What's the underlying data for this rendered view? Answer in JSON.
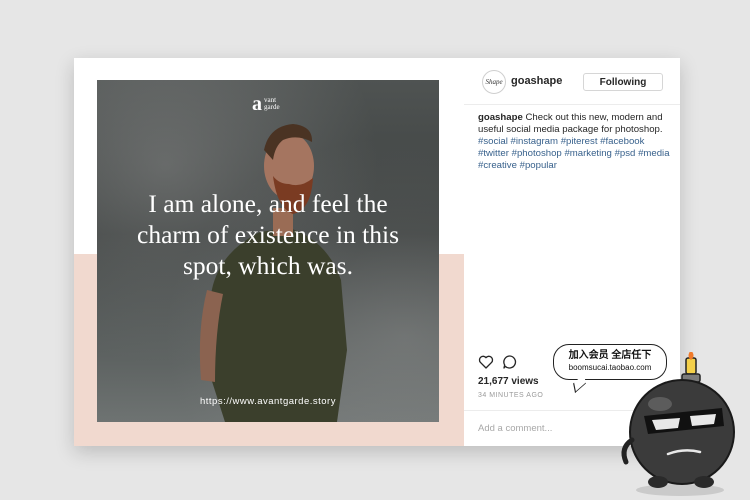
{
  "post": {
    "brand": {
      "mark": "a",
      "name": "vant garde"
    },
    "quote": "I am alone, and feel the charm of existence in this spot, which was.",
    "url": "https://www.avantgarde.story"
  },
  "profile": {
    "avatar_text": "Shape",
    "username": "goashape",
    "follow_label": "Following"
  },
  "caption": {
    "username": "goashape",
    "text": "Check out this new, modern and useful social media package for photoshop.",
    "hashtags": [
      "#social",
      "#instagram",
      "#piterest",
      "#facebook",
      "#twitter",
      "#photoshop",
      "#marketing",
      "#psd",
      "#media",
      "#creative",
      "#popular"
    ]
  },
  "stats": {
    "views": "21,677 views",
    "time": "34 MINUTES AGO"
  },
  "comment": {
    "placeholder": "Add a comment..."
  },
  "overlay": {
    "bubble_title": "加入会员 全店任下",
    "bubble_sub": "boomsucai.taobao.com",
    "mascot_icon": "bomb-mascot-icon"
  },
  "icons": [
    "heart-icon",
    "comment-icon"
  ]
}
